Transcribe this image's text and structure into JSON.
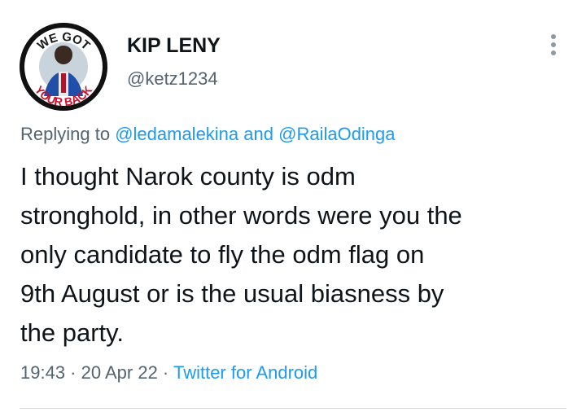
{
  "author": {
    "name": "KIP LENY",
    "handle": "@ketz1234",
    "avatar_badge": "WE GOT YOUR BACK"
  },
  "reply": {
    "prefix": "Replying to ",
    "mention_1": "@ledamalekina",
    "conjunction": " and ",
    "mention_2": "@RailaOdinga"
  },
  "tweet": {
    "text": "I thought Narok county is odm\nstronghold, in other words were you the\nonly candidate to  fly the odm flag on\n9th August or is the usual biasness by\nthe party."
  },
  "meta": {
    "time": "19:43",
    "separator": " · ",
    "date": "20 Apr 22",
    "source": "Twitter for Android"
  },
  "colors": {
    "text": "#0f1419",
    "secondary": "#536471",
    "link": "#1d9bf0",
    "divider": "#cfd9de"
  }
}
